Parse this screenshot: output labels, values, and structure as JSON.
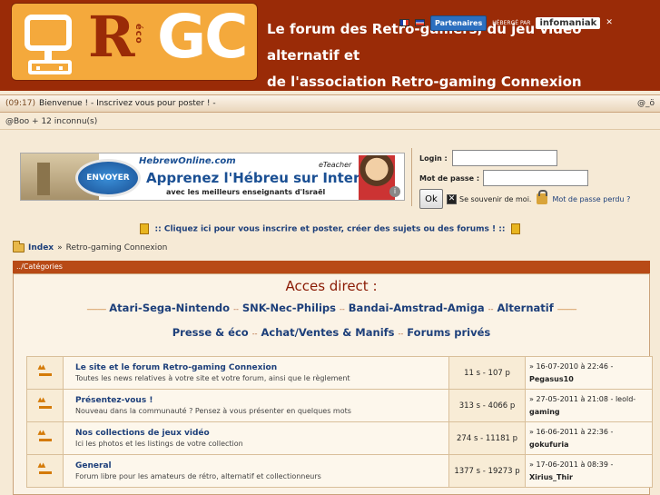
{
  "header": {
    "logo_text_r": "R",
    "logo_text_eco": "éco",
    "logo_text_gc": "GC",
    "description_line1": "Le forum des Retro-gamers, du jeu vidéo alternatif et",
    "description_line2": "de l'association Retro-gaming Connexion",
    "partners_label": "Partenaires",
    "host_label": "HÉBERGÉ PAR",
    "infomaniak_label": "infomaniak",
    "close_label": "✕"
  },
  "welcome_bar": {
    "time": "(09:17)",
    "message": "Bienvenue ! - Inscrivez vous pour poster ! -",
    "right_text": "@_ö"
  },
  "online_bar": {
    "text": "@Boo + 12 inconnu(s)"
  },
  "ad": {
    "send_label": "ENVOYER",
    "brand": "HebrewOnline.com",
    "brand2": "eTeacher",
    "headline": "Apprenez l'Hébreu sur Internet",
    "sub": "avec les meilleurs enseignants d'Israël",
    "info_label": "i"
  },
  "login": {
    "login_label": "Login :",
    "login_value": "",
    "password_label": "Mot de passe :",
    "password_value": "",
    "ok_label": "Ok",
    "remember_label": "Se souvenir de moi.",
    "lost_password_label": "Mot de passe perdu ?"
  },
  "register": {
    "text": ":: Cliquez ici pour vous inscrire et poster, créer des sujets ou des forums ! ::"
  },
  "breadcrumb": {
    "index": "Index",
    "separator": "»",
    "current": "Retro-gaming Connexion"
  },
  "categories": {
    "header": "../Catégories",
    "acces_title": "Acces direct :",
    "nav_row1": [
      "Atari-Sega-Nintendo",
      "SNK-Nec-Philips",
      "Bandai-Amstrad-Amiga",
      "Alternatif"
    ],
    "nav_row2": [
      "Presse & éco",
      "Achat/Ventes & Manifs",
      "Forums privés"
    ],
    "dash": "-----------",
    "sep": "--"
  },
  "forums": [
    {
      "title": "Le site et le forum Retro-gaming Connexion",
      "desc": "Toutes les news relatives à votre site et votre forum, ainsi que le règlement",
      "counts": "11 s - 107 p",
      "last_date": "» 16-07-2010 à 22:46 -",
      "last_user": "Pegasus10"
    },
    {
      "title": "Présentez-vous !",
      "desc": "Nouveau dans la communauté ? Pensez à vous présenter en quelques mots",
      "counts": "313 s - 4066 p",
      "last_date": "» 27-05-2011 à 21:08 - leold-",
      "last_user": "gaming"
    },
    {
      "title": "Nos collections de jeux vidéo",
      "desc": "Ici les photos et les listings de votre collection",
      "counts": "274 s - 11181 p",
      "last_date": "» 16-06-2011 à 22:36 -",
      "last_user": "gokufuria"
    },
    {
      "title": "General",
      "desc": "Forum libre pour les amateurs de rétro, alternatif et collectionneurs",
      "counts": "1377 s - 19273 p",
      "last_date": "» 17-06-2011 à 08:39 -",
      "last_user": "Xirius_Thir"
    }
  ],
  "colors": {
    "header_bg": "#9a2b07",
    "logo_bg": "#f4a93c",
    "link": "#1d3f7a",
    "category_header": "#b84a16",
    "page_bg": "#f6ead6"
  }
}
